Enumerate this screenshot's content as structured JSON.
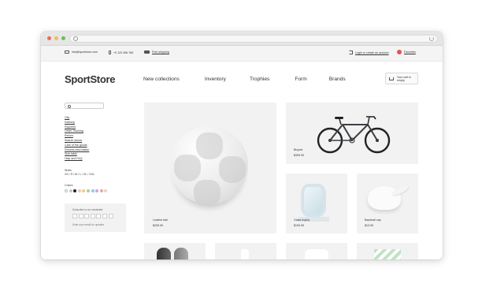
{
  "top_bar": {
    "email": "info@sportstore.com",
    "phone": "+0 123 456 789",
    "shipping": "Free shipping",
    "login": "Login or create an account",
    "favorites": "Favorites"
  },
  "header": {
    "logo": "SportStore",
    "nav": [
      "New collections",
      "Inventory",
      "Trophies",
      "Form",
      "Brands"
    ],
    "cart_text": "Your cart is empty"
  },
  "sidebar": {
    "links": [
      "City",
      "Delivery",
      "Payment",
      "Order Tracking",
      "Return",
      "Search stores",
      "Care of the goods",
      "Returns information",
      "Size table",
      "Help and FAQ"
    ],
    "sizes_label": "Sizes",
    "sizes": "XS / S / M / L / XL / XXL",
    "colors_label": "Colors",
    "colors": [
      "#ffffff",
      "#c9c9c9",
      "#222222",
      "#f2c4c4",
      "#e7d27a",
      "#9fd39f",
      "#9cc4ee",
      "#c5a8e6",
      "#f0a58f",
      "#d9d9d9"
    ],
    "subscribe_title": "Subscribe to our newsletter",
    "subscribe_note": "Enter your email for updates"
  },
  "products": [
    {
      "name": "Leather ball",
      "price": "$299.99",
      "image": "soccer-ball"
    },
    {
      "name": "Bicycle",
      "price": "$399.99",
      "image": "bicycle"
    },
    {
      "name": "Glass trophy",
      "price": "$199.99",
      "image": "glass-trophy"
    },
    {
      "name": "Baseball cap",
      "price": "$19.99",
      "image": "baseball-cap"
    }
  ]
}
